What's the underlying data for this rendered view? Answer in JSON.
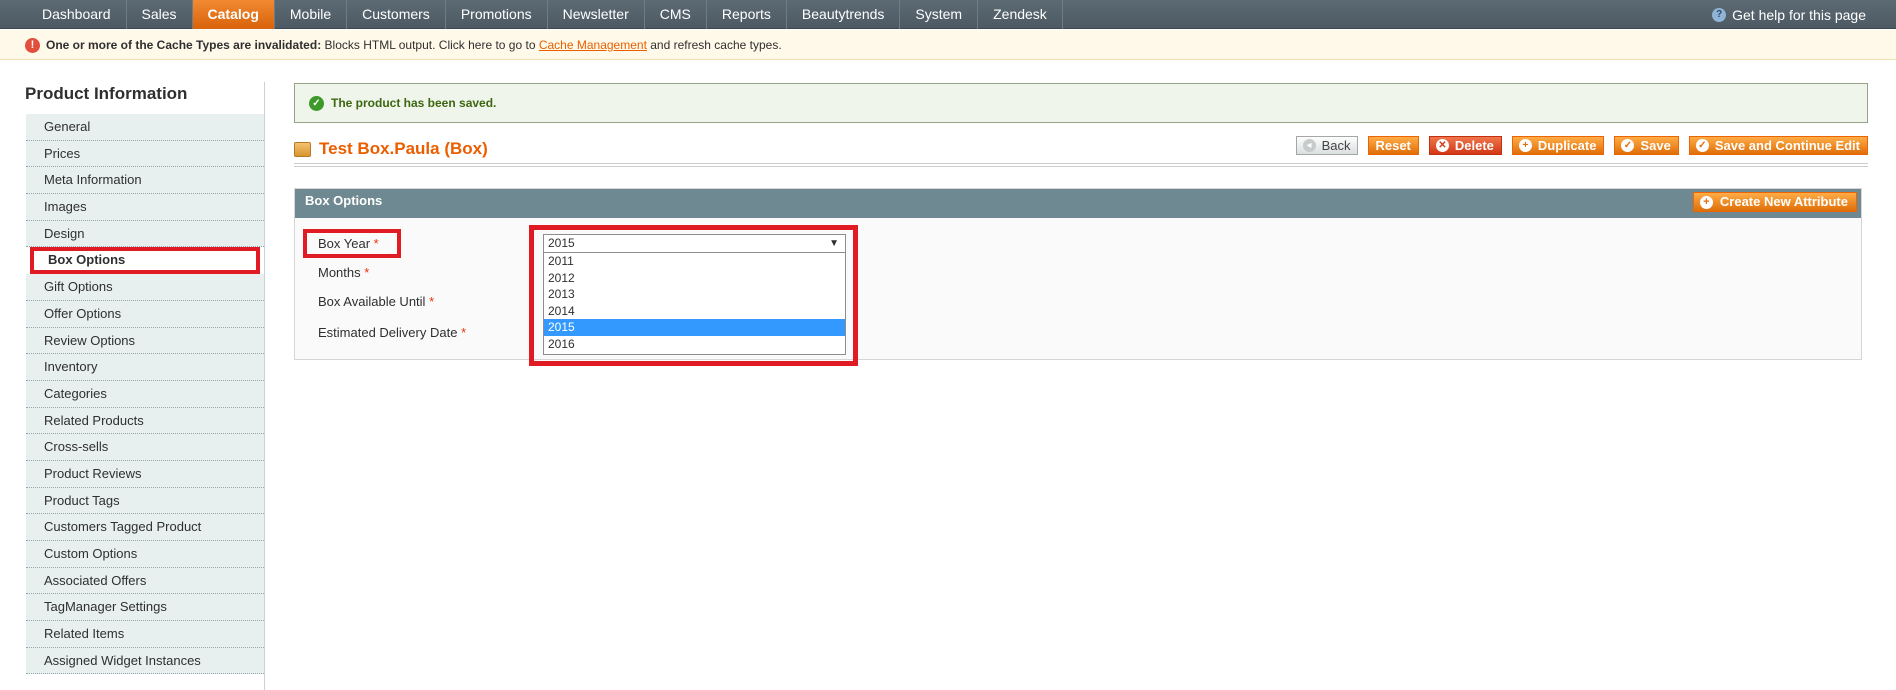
{
  "nav": {
    "items": [
      "Dashboard",
      "Sales",
      "Catalog",
      "Mobile",
      "Customers",
      "Promotions",
      "Newsletter",
      "CMS",
      "Reports",
      "Beautytrends",
      "System",
      "Zendesk"
    ],
    "active": "Catalog",
    "help_label": "Get help for this page"
  },
  "notice": {
    "bold_text": "One or more of the Cache Types are invalidated:",
    "text": " Blocks HTML output. Click here to go to ",
    "link_text": "Cache Management",
    "tail_text": " and refresh cache types."
  },
  "sidebar": {
    "title": "Product Information",
    "tabs": [
      "General",
      "Prices",
      "Meta Information",
      "Images",
      "Design",
      "Box Options",
      "Gift Options",
      "Offer Options",
      "Review Options",
      "Inventory",
      "Categories",
      "Related Products",
      "Cross-sells",
      "Product Reviews",
      "Product Tags",
      "Customers Tagged Product",
      "Custom Options",
      "Associated Offers",
      "TagManager Settings",
      "Related Items",
      "Assigned Widget Instances"
    ],
    "active_tab": "Box Options"
  },
  "message": {
    "success": "The product has been saved."
  },
  "header": {
    "title": "Test Box.Paula (Box)",
    "buttons": {
      "back": "Back",
      "reset": "Reset",
      "delete": "Delete",
      "duplicate": "Duplicate",
      "save": "Save",
      "save_continue": "Save and Continue Edit"
    }
  },
  "panel": {
    "title": "Box Options",
    "create_button": "Create New Attribute",
    "fields": [
      "Box Year",
      "Months",
      "Box Available Until",
      "Estimated Delivery Date"
    ],
    "required_mark": "*",
    "box_year": {
      "value": "2015",
      "options": [
        "2011",
        "2012",
        "2013",
        "2014",
        "2015",
        "2016"
      ],
      "highlighted": "2015"
    }
  },
  "colors": {
    "accent": "#eb5e00",
    "highlight_box": "#e01b24",
    "selected_option": "#3399ff"
  }
}
